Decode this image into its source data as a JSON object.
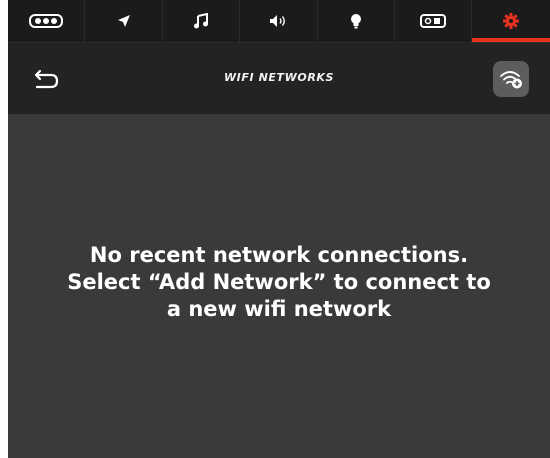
{
  "tabs": [
    {
      "icon": "vehicle-icon"
    },
    {
      "icon": "navigation-icon"
    },
    {
      "icon": "music-icon"
    },
    {
      "icon": "volume-icon"
    },
    {
      "icon": "light-bulb-icon"
    },
    {
      "icon": "toggle-icon"
    },
    {
      "icon": "gear-icon",
      "active": true
    }
  ],
  "header": {
    "back_icon": "back-arrow-icon",
    "title": "WIFI NETWORKS",
    "action_icon": "wifi-add-icon"
  },
  "main": {
    "message_lines": [
      "No recent network connections.",
      "Select “Add Network” to connect to",
      "a new wifi network"
    ]
  },
  "colors": {
    "accent": "#e8321f",
    "background": "#3a3a3a",
    "header": "#232323",
    "tabbar": "#1b1b1b"
  }
}
